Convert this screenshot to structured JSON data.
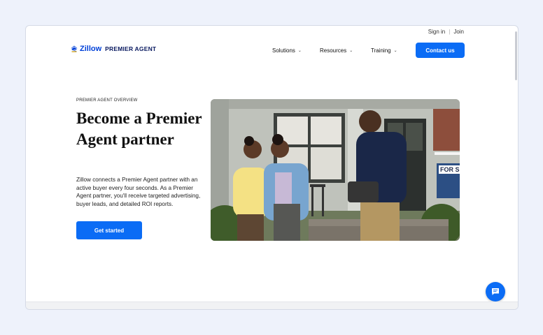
{
  "util_nav": {
    "sign_in": "Sign in",
    "join": "Join"
  },
  "logo": {
    "brand": "Zillow",
    "product": "PREMIER AGENT"
  },
  "nav": {
    "solutions": "Solutions",
    "resources": "Resources",
    "training": "Training",
    "contact": "Contact us"
  },
  "hero": {
    "overline": "PREMIER AGENT OVERVIEW",
    "headline": "Become a Premier Agent partner",
    "body": "Zillow connects a Premier Agent partner with an active buyer every four seconds. As a Premier Agent partner, you'll receive targeted advertising, buyer leads, and detailed ROI reports.",
    "cta": "Get started",
    "sign_text": "FOR S"
  },
  "icons": {
    "logo": "zillow-house-icon",
    "chevron": "chevron-down-icon",
    "chat": "chat-bubble-icon"
  },
  "colors": {
    "accent": "#0b6cf5",
    "brand_blue": "#0041d9",
    "navy": "#0a1a60",
    "page_bg": "#eef2fb"
  }
}
